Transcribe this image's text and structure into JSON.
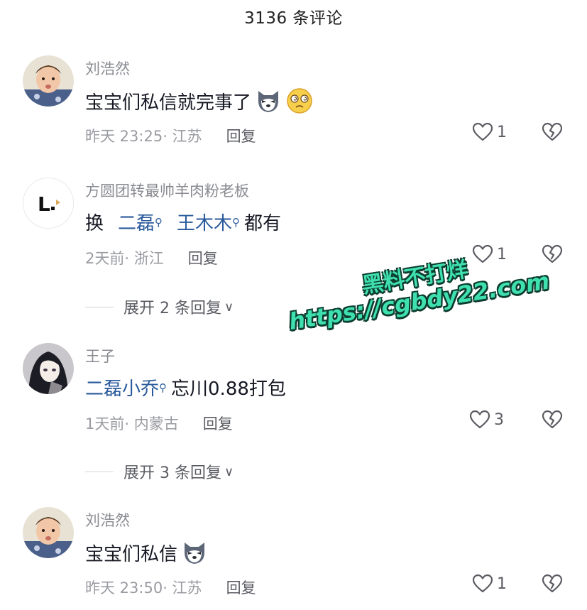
{
  "header": {
    "title": "3136 条评论"
  },
  "icons": {
    "like": "heart-outline-icon",
    "dislike": "broken-heart-icon",
    "mention": "search-icon",
    "expand": "chevron-down-icon"
  },
  "comments": [
    {
      "username": "刘浩然",
      "text": "宝宝们私信就完事了",
      "emojis": [
        "husky-emoji",
        "dizzy-face-emoji"
      ],
      "time": "昨天 23:25",
      "location": "· 江苏",
      "reply_label": "回复",
      "likes": "1"
    },
    {
      "username": "方圆团转最帅羊肉粉老板",
      "text_prefix": "换",
      "mentions": [
        "二磊",
        "王木木"
      ],
      "text_suffix": "都有",
      "time": "2天前",
      "location": "· 浙江",
      "reply_label": "回复",
      "likes": "1",
      "expand_label": "展开 2 条回复"
    },
    {
      "username": "王子",
      "mentions": [
        "二磊小乔"
      ],
      "text_suffix": "忘川0.88打包",
      "time": "1天前",
      "location": "· 内蒙古",
      "reply_label": "回复",
      "likes": "3",
      "expand_label": "展开 3 条回复"
    },
    {
      "username": "刘浩然",
      "text": "宝宝们私信",
      "emojis": [
        "husky-emoji"
      ],
      "time": "昨天 23:50",
      "location": "· 江苏",
      "reply_label": "回复",
      "likes": "1"
    }
  ],
  "watermark": {
    "line1": "黑料不打烊",
    "line2": "https://cgbdy22.com"
  },
  "colors": {
    "mention": "#2a5a9c",
    "watermark": "#3fe0b0",
    "text": "#161823",
    "secondary": "#9a9ba1"
  }
}
